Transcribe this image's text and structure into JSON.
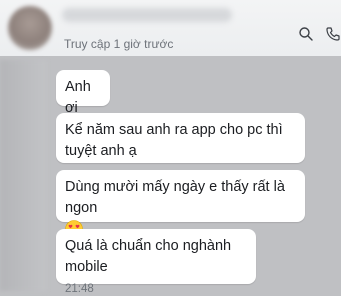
{
  "header": {
    "last_seen": "Truy cập 1 giờ trước",
    "icons": [
      "search-icon",
      "call-icon"
    ]
  },
  "messages": [
    {
      "text": "Anh ơi"
    },
    {
      "text": "Kể năm sau anh ra app cho pc thì tuyệt anh ạ"
    },
    {
      "text": "Dùng mười mấy ngày e thấy rất là ngon",
      "emoji": "smiling-face-with-heart-eyes"
    },
    {
      "text": "Quá là chuẩn cho nghành mobile",
      "time": "21:48"
    }
  ]
}
